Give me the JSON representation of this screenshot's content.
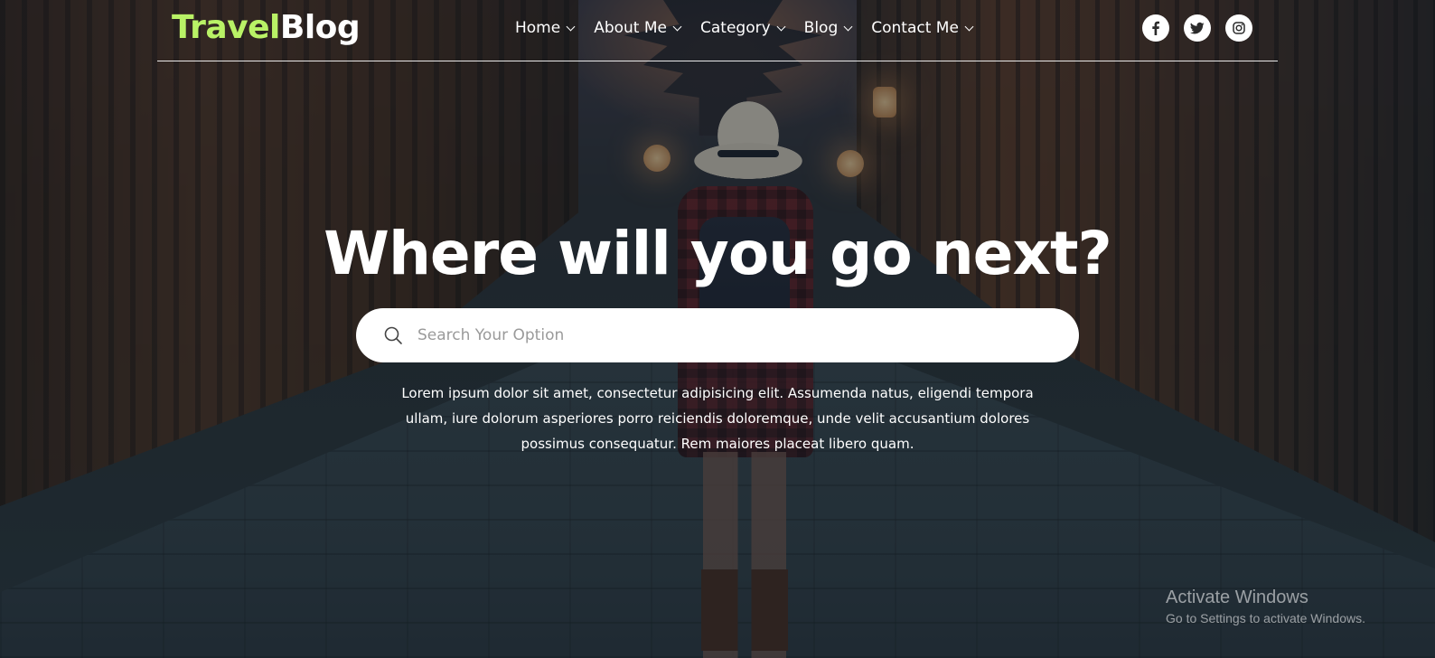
{
  "brand": {
    "logo_accent": "Travel",
    "logo_rest": "Blog",
    "accent_color": "#b9f266"
  },
  "nav": {
    "items": [
      {
        "label": "Home",
        "icon": "chevron-down-icon"
      },
      {
        "label": "About Me",
        "icon": "chevron-down-icon"
      },
      {
        "label": "Category",
        "icon": "chevron-down-icon"
      },
      {
        "label": "Blog",
        "icon": "chevron-down-icon"
      },
      {
        "label": "Contact Me",
        "icon": "chevron-down-icon"
      }
    ]
  },
  "social": {
    "icons": [
      "facebook-icon",
      "twitter-icon",
      "instagram-icon"
    ]
  },
  "hero": {
    "title": "Where will you go next?",
    "search_placeholder": "Search Your Option",
    "search_value": "",
    "description": "Lorem ipsum dolor sit amet, consectetur adipisicing elit. Assumenda natus, eligendi tempora ullam, iure dolorum asperiores porro reiciendis doloremque, unde velit accusantium dolores possimus consequatur. Rem maiores placeat libero quam."
  },
  "watermark": {
    "title": "Activate Windows",
    "subtitle": "Go to Settings to activate Windows."
  }
}
